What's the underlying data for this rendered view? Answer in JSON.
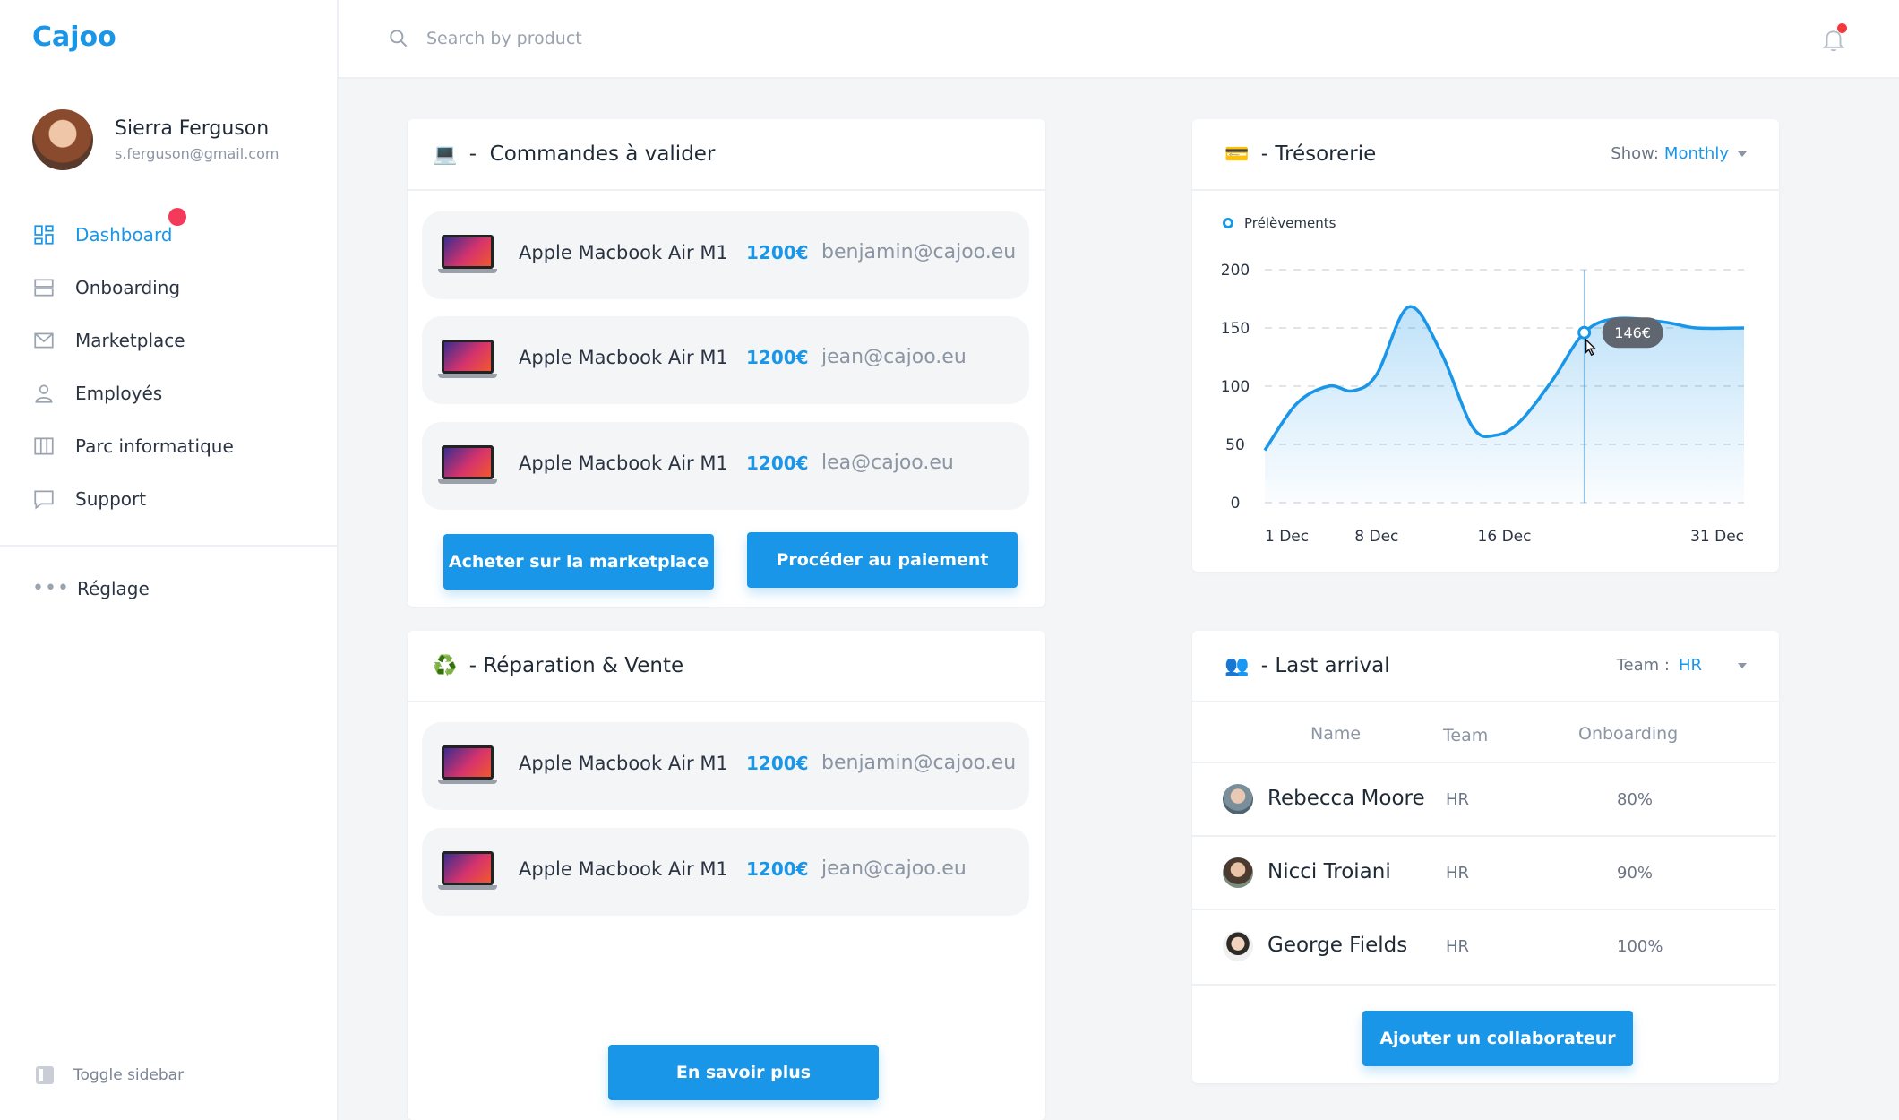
{
  "app": {
    "logo": "Cajoo"
  },
  "user": {
    "name": "Sierra Ferguson",
    "email": "s.ferguson@gmail.com"
  },
  "sidebar": {
    "items": [
      {
        "label": "Dashboard",
        "icon": "grid-icon"
      },
      {
        "label": "Onboarding",
        "icon": "layers-icon"
      },
      {
        "label": "Marketplace",
        "icon": "mail-icon"
      },
      {
        "label": "Employés",
        "icon": "user-icon"
      },
      {
        "label": "Parc informatique",
        "icon": "columns-icon"
      },
      {
        "label": "Support",
        "icon": "chat-icon"
      }
    ],
    "settings_label": "Réglage",
    "toggle_label": "Toggle sidebar"
  },
  "search": {
    "placeholder": "Search by product"
  },
  "orders": {
    "title": "Commandes à valider",
    "emoji": "💻",
    "rows": [
      {
        "product": "Apple Macbook Air M1",
        "price": "1200€",
        "email": "benjamin@cajoo.eu"
      },
      {
        "product": "Apple Macbook Air M1",
        "price": "1200€",
        "email": "jean@cajoo.eu"
      },
      {
        "product": "Apple Macbook Air M1",
        "price": "1200€",
        "email": "lea@cajoo.eu"
      }
    ],
    "btn_marketplace": "Acheter sur la marketplace",
    "btn_payment": "Procéder au paiement"
  },
  "repair": {
    "title": "Réparation & Vente",
    "emoji": "♻️",
    "rows": [
      {
        "product": "Apple Macbook Air M1",
        "price": "1200€",
        "email": "benjamin@cajoo.eu"
      },
      {
        "product": "Apple Macbook Air M1",
        "price": "1200€",
        "email": "jean@cajoo.eu"
      }
    ],
    "btn_more": "En savoir plus"
  },
  "treasury": {
    "title": "Trésorerie",
    "emoji": "💳",
    "show_label": "Show:",
    "show_value": "Monthly",
    "tooltip": "146€"
  },
  "chart_data": {
    "type": "area",
    "series": [
      {
        "name": "Prélèvements",
        "x": [
          0,
          2,
          4,
          5.5,
          7,
          9,
          11,
          13,
          14.5,
          16,
          18,
          20,
          22,
          25,
          27,
          30
        ],
        "values": [
          45,
          85,
          100,
          96,
          110,
          168,
          130,
          65,
          58,
          70,
          105,
          146,
          158,
          155,
          150,
          150
        ]
      }
    ],
    "x_tick_labels": [
      "1 Dec",
      "8 Dec",
      "16 Dec",
      "31 Dec"
    ],
    "x_tick_positions": [
      0,
      7,
      15,
      30
    ],
    "xlim": [
      0,
      30
    ],
    "ylim": [
      0,
      200
    ],
    "y_ticks": [
      0,
      50,
      100,
      150,
      200
    ],
    "highlight": {
      "x": 20,
      "y": 146,
      "label": "146€"
    },
    "grid": true,
    "legend": "top-left",
    "color": "#1a96e8"
  },
  "arrivals": {
    "title": "Last arrival",
    "emoji": "👥",
    "team_label": "Team :",
    "team_value": "HR",
    "columns": [
      "Name",
      "Team",
      "Onboarding"
    ],
    "rows": [
      {
        "name": "Rebecca Moore",
        "team": "HR",
        "onboarding": "80%"
      },
      {
        "name": "Nicci Troiani",
        "team": "HR",
        "onboarding": "90%"
      },
      {
        "name": "George Fields",
        "team": "HR",
        "onboarding": "100%"
      }
    ],
    "btn_add": "Ajouter un collaborateur"
  }
}
